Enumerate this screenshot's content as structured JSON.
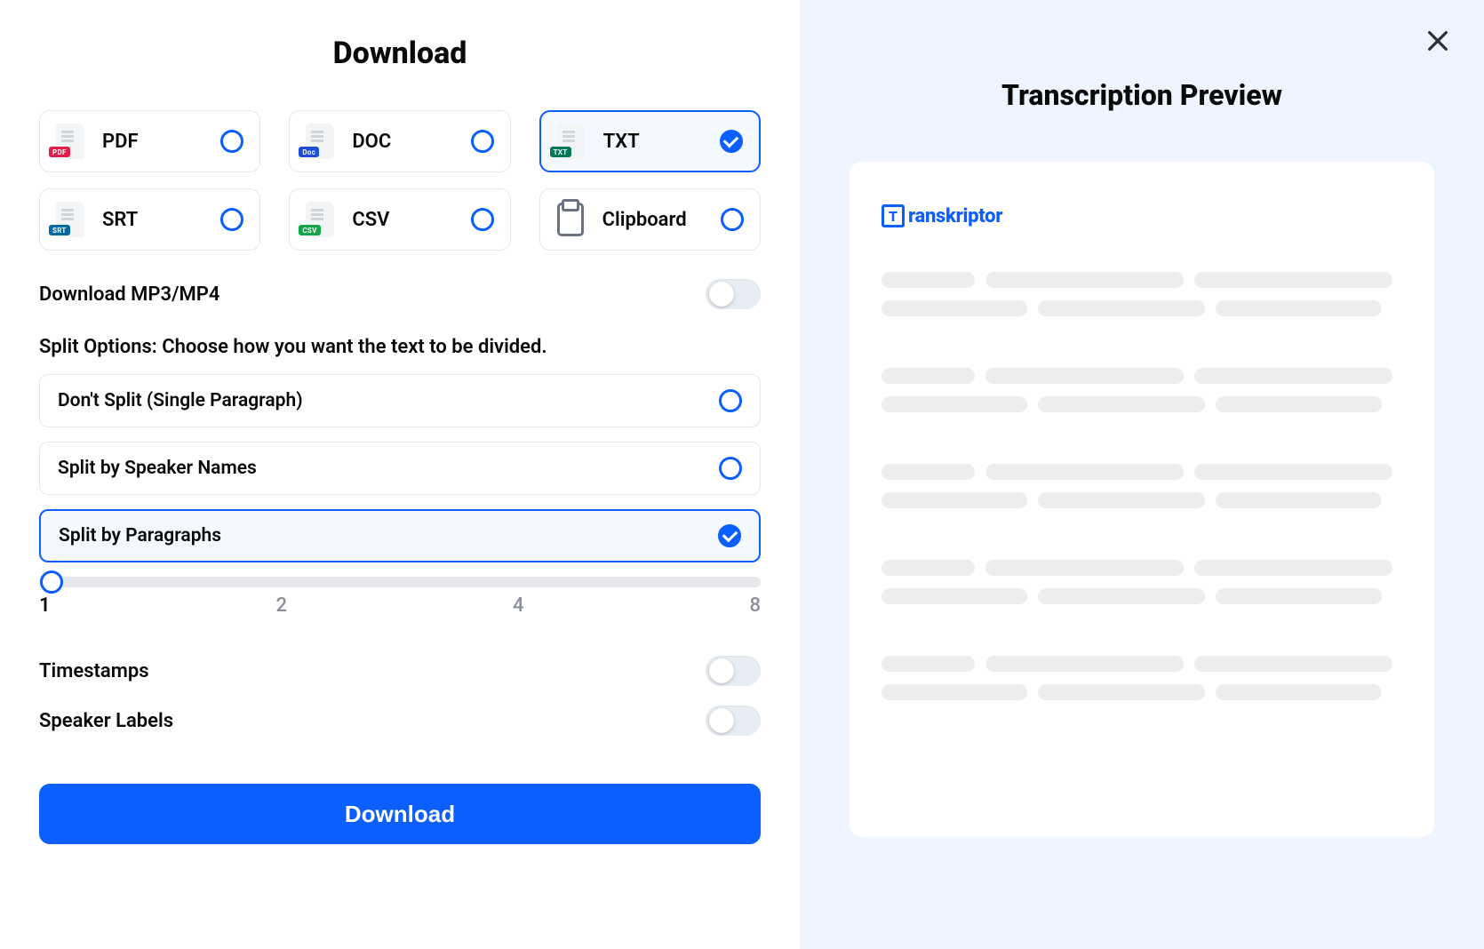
{
  "left": {
    "title": "Download",
    "formats": [
      {
        "id": "pdf",
        "label": "PDF",
        "badge": "PDF",
        "badgeClass": "badge-pdf",
        "selected": false
      },
      {
        "id": "doc",
        "label": "DOC",
        "badge": "Doc",
        "badgeClass": "badge-doc",
        "selected": false
      },
      {
        "id": "txt",
        "label": "TXT",
        "badge": "TXT",
        "badgeClass": "badge-txt",
        "selected": true
      },
      {
        "id": "srt",
        "label": "SRT",
        "badge": "SRT",
        "badgeClass": "badge-srt",
        "selected": false
      },
      {
        "id": "csv",
        "label": "CSV",
        "badge": "CSV",
        "badgeClass": "badge-csv",
        "selected": false
      },
      {
        "id": "clipboard",
        "label": "Clipboard",
        "badge": null,
        "badgeClass": null,
        "selected": false
      }
    ],
    "download_media_label": "Download MP3/MP4",
    "download_media_on": false,
    "split_section_label": "Split Options: Choose how you want the text to be divided.",
    "split_options": [
      {
        "id": "nosplit",
        "label": "Don't Split (Single Paragraph)",
        "selected": false
      },
      {
        "id": "speaker",
        "label": "Split by Speaker Names",
        "selected": false
      },
      {
        "id": "paragraphs",
        "label": "Split by Paragraphs",
        "selected": true
      }
    ],
    "slider": {
      "value": 1,
      "ticks": [
        "1",
        "2",
        "4",
        "8"
      ]
    },
    "timestamps_label": "Timestamps",
    "timestamps_on": false,
    "speaker_labels_label": "Speaker Labels",
    "speaker_labels_on": false,
    "download_button": "Download"
  },
  "right": {
    "preview_title": "Transcription Preview",
    "brand_letter": "T",
    "brand_rest": "ranskriptor"
  }
}
